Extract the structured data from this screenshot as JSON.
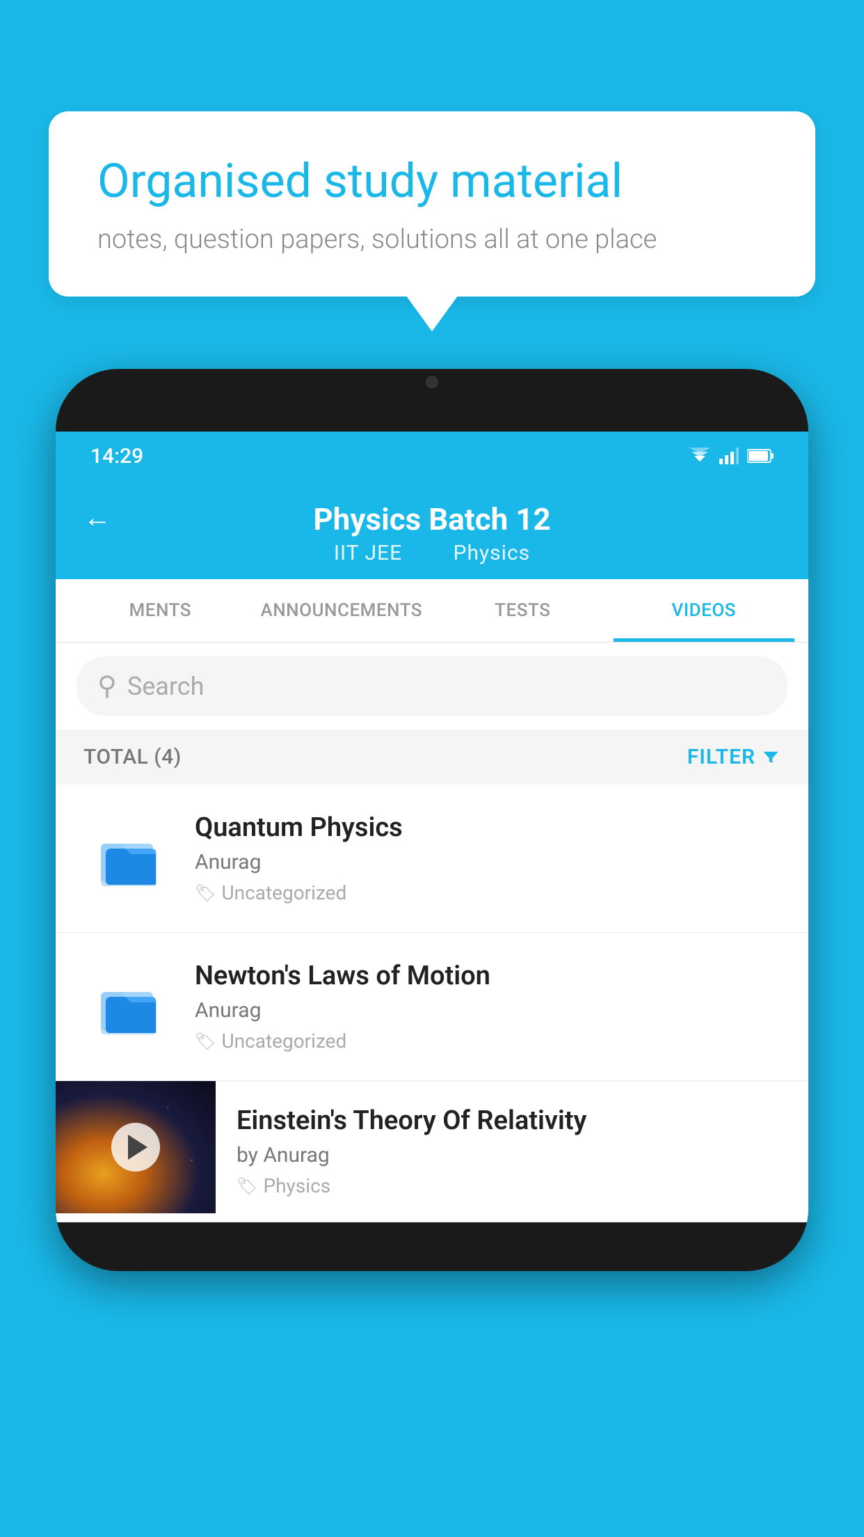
{
  "background_color": "#1ab8e8",
  "speech_bubble": {
    "title": "Organised study material",
    "subtitle": "notes, question papers, solutions all at one place"
  },
  "phone": {
    "status_bar": {
      "time": "14:29"
    },
    "header": {
      "back_label": "←",
      "title": "Physics Batch 12",
      "subtitle_part1": "IIT JEE",
      "subtitle_part2": "Physics"
    },
    "tabs": [
      {
        "label": "MENTS",
        "active": false
      },
      {
        "label": "ANNOUNCEMENTS",
        "active": false
      },
      {
        "label": "TESTS",
        "active": false
      },
      {
        "label": "VIDEOS",
        "active": true
      }
    ],
    "search": {
      "placeholder": "Search"
    },
    "filter_row": {
      "total_label": "TOTAL (4)",
      "filter_label": "FILTER"
    },
    "videos": [
      {
        "id": "quantum",
        "title": "Quantum Physics",
        "author": "Anurag",
        "tag": "Uncategorized",
        "has_thumbnail": false
      },
      {
        "id": "newton",
        "title": "Newton's Laws of Motion",
        "author": "Anurag",
        "tag": "Uncategorized",
        "has_thumbnail": false
      },
      {
        "id": "einstein",
        "title": "Einstein's Theory Of Relativity",
        "author": "by Anurag",
        "tag": "Physics",
        "has_thumbnail": true
      }
    ]
  }
}
